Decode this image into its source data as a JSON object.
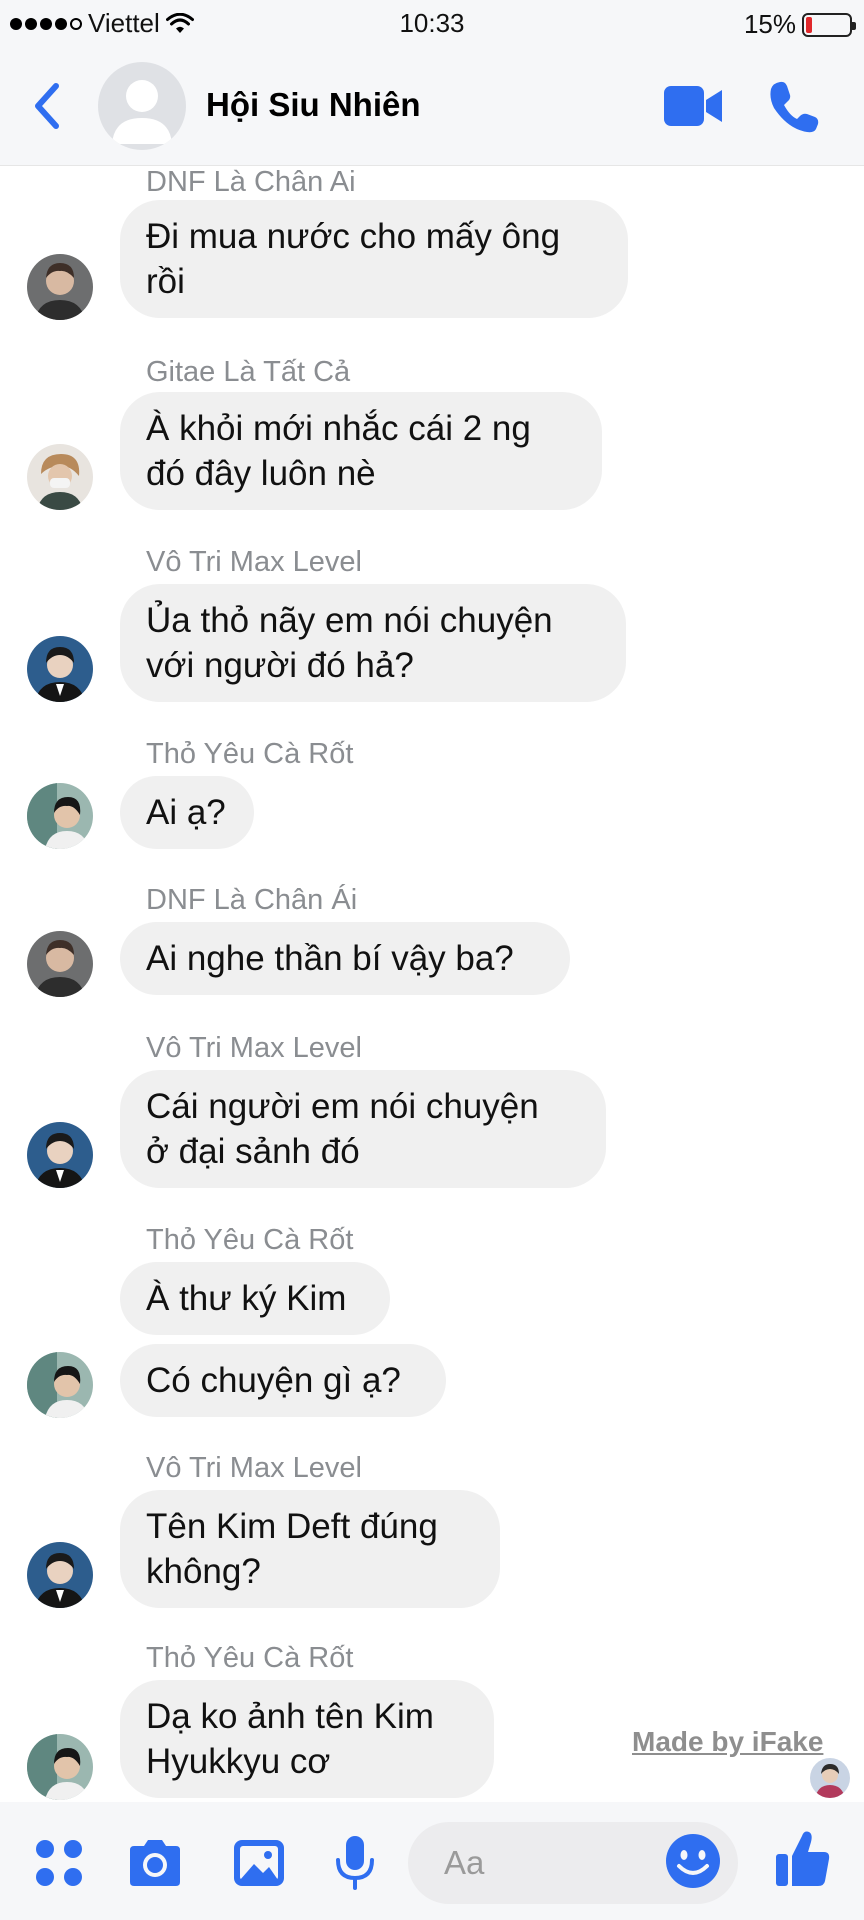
{
  "status_bar": {
    "carrier": "Viettel",
    "time": "10:33",
    "battery_percent": "15%",
    "battery_level": 0.15,
    "signal_bars": 4,
    "icons": [
      "signal-dots-icon",
      "wifi-icon",
      "battery-icon"
    ]
  },
  "header": {
    "title": "Hội Siu Nhiên",
    "icons": [
      "back-chevron-icon",
      "group-avatar-icon",
      "video-camera-icon",
      "phone-icon"
    ],
    "accent_color": "#2f6ef0"
  },
  "messages": [
    {
      "sender": "DNF Là Chân Ai",
      "texts": [
        "Đi mua nước cho mấy ông\nrồi"
      ]
    },
    {
      "sender": "Gitae Là Tất Cả",
      "texts": [
        "À khỏi mới nhắc cái 2 ng\nđó đây luôn nè"
      ]
    },
    {
      "sender": "Vô Tri Max Level",
      "texts": [
        "Ủa thỏ nãy em nói chuyện\nvới người đó hả?"
      ]
    },
    {
      "sender": "Thỏ Yêu Cà Rốt",
      "texts": [
        "Ai ạ?"
      ]
    },
    {
      "sender": "DNF Là Chân Ái",
      "texts": [
        "Ai nghe thần bí vậy ba?"
      ]
    },
    {
      "sender": "Vô Tri Max Level",
      "texts": [
        "Cái người em nói chuyện\nở đại sảnh đó"
      ]
    },
    {
      "sender": "Thỏ Yêu Cà Rốt",
      "texts": [
        "À thư ký Kim",
        "Có chuyện gì ạ?"
      ]
    },
    {
      "sender": "Vô Tri Max Level",
      "texts": [
        "Tên Kim Deft đúng\nkhông?"
      ]
    },
    {
      "sender": "Thỏ Yêu Cà Rốt",
      "texts": [
        "Dạ ko ảnh tên Kim\nHyukkyu cơ"
      ]
    }
  ],
  "watermark": "Made by iFake",
  "composer": {
    "placeholder": "Aa",
    "icons": [
      "apps-grid-icon",
      "camera-icon",
      "photo-gallery-icon",
      "microphone-icon",
      "emoji-icon",
      "thumbs-up-icon"
    ]
  },
  "colors": {
    "accent": "#2f6ef0",
    "bubble": "#f0f0f0",
    "sender_name": "#8a8d91",
    "battery_low": "#e0282b"
  }
}
